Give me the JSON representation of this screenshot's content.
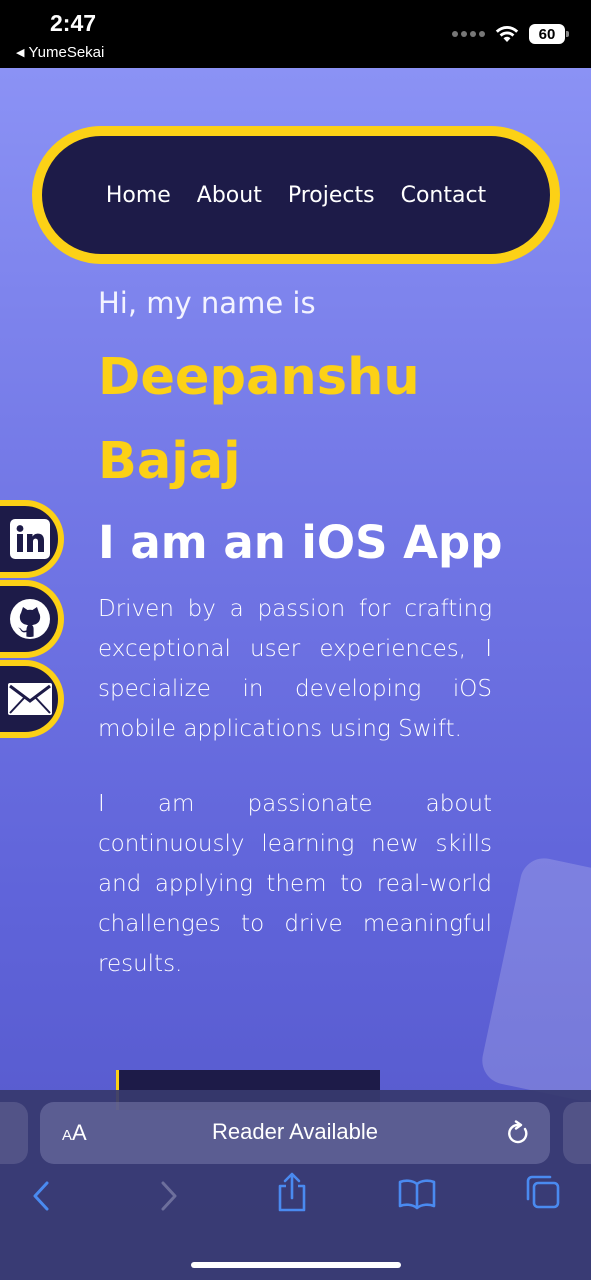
{
  "status_bar": {
    "time": "2:47",
    "back_app": "YumeSekai",
    "battery": "60"
  },
  "nav": {
    "links": [
      "Home",
      "About",
      "Projects",
      "Contact"
    ]
  },
  "hero": {
    "greeting": "Hi, my name is",
    "name": "Deepanshu Bajaj",
    "role": "I am an iOS App",
    "para1": "Driven by a passion for crafting exceptional user experiences, I specialize in developing iOS mobile applications using Swift.",
    "para2": "I am passionate about continuously learning new skills and applying them to real-world challenges to drive meaningful results."
  },
  "social": [
    "linkedin-icon",
    "github-icon",
    "mail-icon"
  ],
  "browser": {
    "aa_label_small": "A",
    "aa_label_large": "A",
    "reader_text": "Reader Available",
    "toolbar": [
      "back-icon",
      "forward-icon",
      "share-icon",
      "bookmarks-icon",
      "tabs-icon"
    ]
  },
  "colors": {
    "accent": "#fcd116",
    "nav_bg": "#1d1b48",
    "toolbar_icon": "#4a8af0"
  }
}
